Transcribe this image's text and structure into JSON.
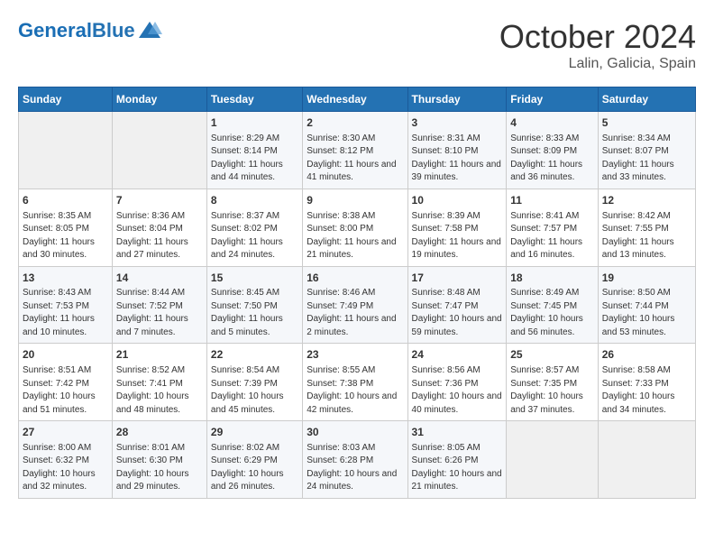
{
  "header": {
    "logo_general": "General",
    "logo_blue": "Blue",
    "month": "October 2024",
    "location": "Lalin, Galicia, Spain"
  },
  "weekdays": [
    "Sunday",
    "Monday",
    "Tuesday",
    "Wednesday",
    "Thursday",
    "Friday",
    "Saturday"
  ],
  "weeks": [
    [
      {
        "day": "",
        "content": ""
      },
      {
        "day": "",
        "content": ""
      },
      {
        "day": "1",
        "content": "Sunrise: 8:29 AM\nSunset: 8:14 PM\nDaylight: 11 hours and 44 minutes."
      },
      {
        "day": "2",
        "content": "Sunrise: 8:30 AM\nSunset: 8:12 PM\nDaylight: 11 hours and 41 minutes."
      },
      {
        "day": "3",
        "content": "Sunrise: 8:31 AM\nSunset: 8:10 PM\nDaylight: 11 hours and 39 minutes."
      },
      {
        "day": "4",
        "content": "Sunrise: 8:33 AM\nSunset: 8:09 PM\nDaylight: 11 hours and 36 minutes."
      },
      {
        "day": "5",
        "content": "Sunrise: 8:34 AM\nSunset: 8:07 PM\nDaylight: 11 hours and 33 minutes."
      }
    ],
    [
      {
        "day": "6",
        "content": "Sunrise: 8:35 AM\nSunset: 8:05 PM\nDaylight: 11 hours and 30 minutes."
      },
      {
        "day": "7",
        "content": "Sunrise: 8:36 AM\nSunset: 8:04 PM\nDaylight: 11 hours and 27 minutes."
      },
      {
        "day": "8",
        "content": "Sunrise: 8:37 AM\nSunset: 8:02 PM\nDaylight: 11 hours and 24 minutes."
      },
      {
        "day": "9",
        "content": "Sunrise: 8:38 AM\nSunset: 8:00 PM\nDaylight: 11 hours and 21 minutes."
      },
      {
        "day": "10",
        "content": "Sunrise: 8:39 AM\nSunset: 7:58 PM\nDaylight: 11 hours and 19 minutes."
      },
      {
        "day": "11",
        "content": "Sunrise: 8:41 AM\nSunset: 7:57 PM\nDaylight: 11 hours and 16 minutes."
      },
      {
        "day": "12",
        "content": "Sunrise: 8:42 AM\nSunset: 7:55 PM\nDaylight: 11 hours and 13 minutes."
      }
    ],
    [
      {
        "day": "13",
        "content": "Sunrise: 8:43 AM\nSunset: 7:53 PM\nDaylight: 11 hours and 10 minutes."
      },
      {
        "day": "14",
        "content": "Sunrise: 8:44 AM\nSunset: 7:52 PM\nDaylight: 11 hours and 7 minutes."
      },
      {
        "day": "15",
        "content": "Sunrise: 8:45 AM\nSunset: 7:50 PM\nDaylight: 11 hours and 5 minutes."
      },
      {
        "day": "16",
        "content": "Sunrise: 8:46 AM\nSunset: 7:49 PM\nDaylight: 11 hours and 2 minutes."
      },
      {
        "day": "17",
        "content": "Sunrise: 8:48 AM\nSunset: 7:47 PM\nDaylight: 10 hours and 59 minutes."
      },
      {
        "day": "18",
        "content": "Sunrise: 8:49 AM\nSunset: 7:45 PM\nDaylight: 10 hours and 56 minutes."
      },
      {
        "day": "19",
        "content": "Sunrise: 8:50 AM\nSunset: 7:44 PM\nDaylight: 10 hours and 53 minutes."
      }
    ],
    [
      {
        "day": "20",
        "content": "Sunrise: 8:51 AM\nSunset: 7:42 PM\nDaylight: 10 hours and 51 minutes."
      },
      {
        "day": "21",
        "content": "Sunrise: 8:52 AM\nSunset: 7:41 PM\nDaylight: 10 hours and 48 minutes."
      },
      {
        "day": "22",
        "content": "Sunrise: 8:54 AM\nSunset: 7:39 PM\nDaylight: 10 hours and 45 minutes."
      },
      {
        "day": "23",
        "content": "Sunrise: 8:55 AM\nSunset: 7:38 PM\nDaylight: 10 hours and 42 minutes."
      },
      {
        "day": "24",
        "content": "Sunrise: 8:56 AM\nSunset: 7:36 PM\nDaylight: 10 hours and 40 minutes."
      },
      {
        "day": "25",
        "content": "Sunrise: 8:57 AM\nSunset: 7:35 PM\nDaylight: 10 hours and 37 minutes."
      },
      {
        "day": "26",
        "content": "Sunrise: 8:58 AM\nSunset: 7:33 PM\nDaylight: 10 hours and 34 minutes."
      }
    ],
    [
      {
        "day": "27",
        "content": "Sunrise: 8:00 AM\nSunset: 6:32 PM\nDaylight: 10 hours and 32 minutes."
      },
      {
        "day": "28",
        "content": "Sunrise: 8:01 AM\nSunset: 6:30 PM\nDaylight: 10 hours and 29 minutes."
      },
      {
        "day": "29",
        "content": "Sunrise: 8:02 AM\nSunset: 6:29 PM\nDaylight: 10 hours and 26 minutes."
      },
      {
        "day": "30",
        "content": "Sunrise: 8:03 AM\nSunset: 6:28 PM\nDaylight: 10 hours and 24 minutes."
      },
      {
        "day": "31",
        "content": "Sunrise: 8:05 AM\nSunset: 6:26 PM\nDaylight: 10 hours and 21 minutes."
      },
      {
        "day": "",
        "content": ""
      },
      {
        "day": "",
        "content": ""
      }
    ]
  ]
}
